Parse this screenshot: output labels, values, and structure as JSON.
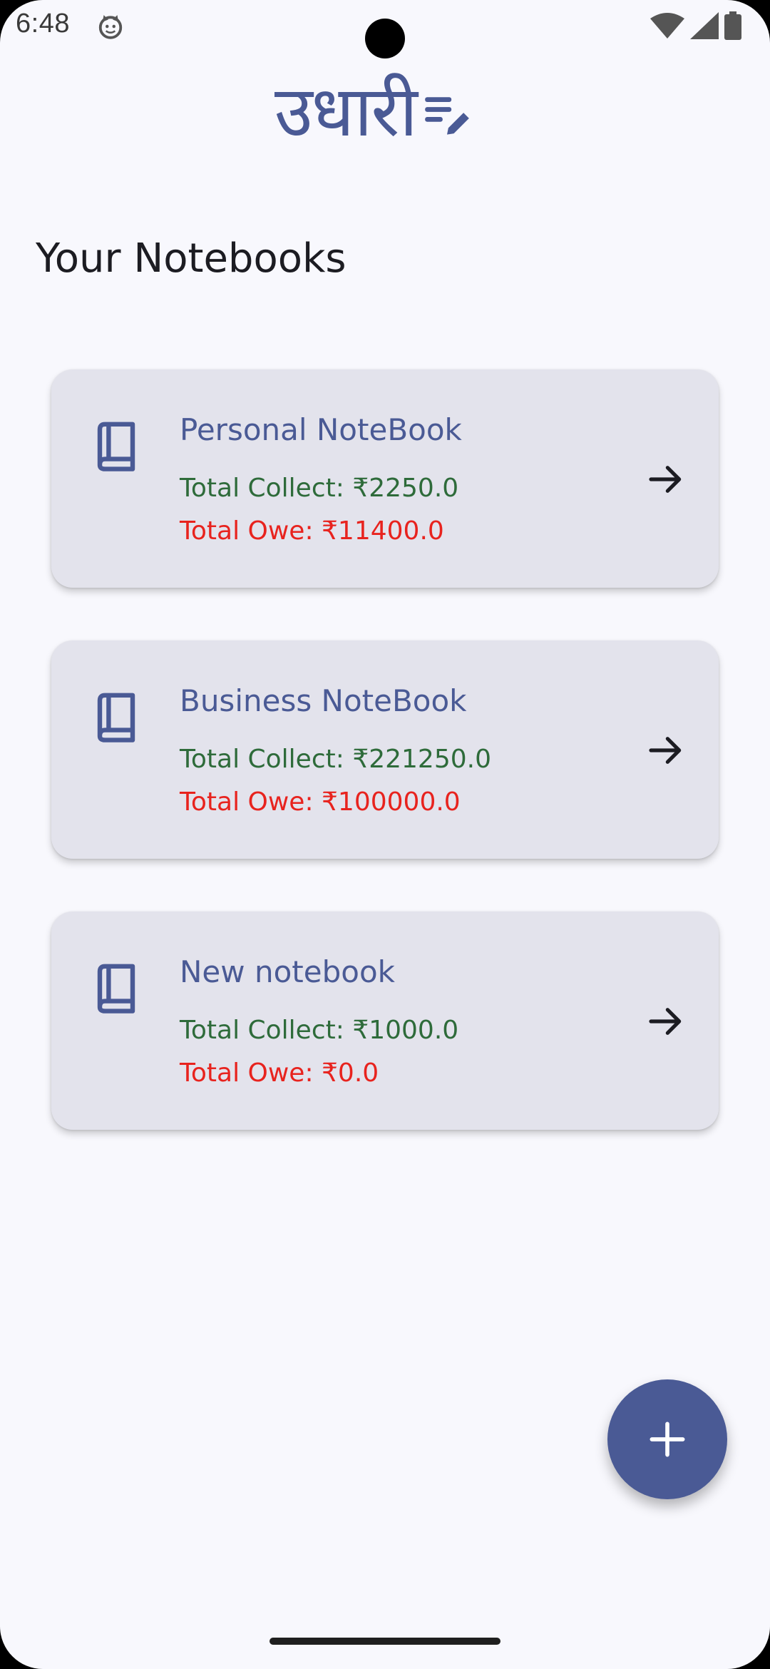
{
  "status_bar": {
    "time": "6:48",
    "icons": [
      "cat-notification-icon",
      "wifi-icon",
      "signal-icon",
      "battery-icon"
    ]
  },
  "app": {
    "logo_text": "उधारी",
    "logo_icon": "notes-edit-icon",
    "brand_color": "#4a5a95"
  },
  "page": {
    "title": "Your Notebooks"
  },
  "notebooks": [
    {
      "name": "Personal NoteBook",
      "collect_label": "Total Collect: ₹2250.0",
      "owe_label": "Total Owe: ₹11400.0",
      "icon": "book-icon",
      "action_icon": "arrow-right-icon"
    },
    {
      "name": "Business NoteBook",
      "collect_label": "Total Collect: ₹221250.0",
      "owe_label": "Total Owe: ₹100000.0",
      "icon": "book-icon",
      "action_icon": "arrow-right-icon"
    },
    {
      "name": "New notebook",
      "collect_label": "Total Collect: ₹1000.0",
      "owe_label": "Total Owe: ₹0.0",
      "icon": "book-icon",
      "action_icon": "arrow-right-icon"
    }
  ],
  "fab": {
    "icon": "plus-icon"
  },
  "colors": {
    "background": "#f8f8fd",
    "card": "#e3e3ec",
    "collect": "#2e6b3a",
    "owe": "#e8231e",
    "title": "#1c1c22"
  }
}
